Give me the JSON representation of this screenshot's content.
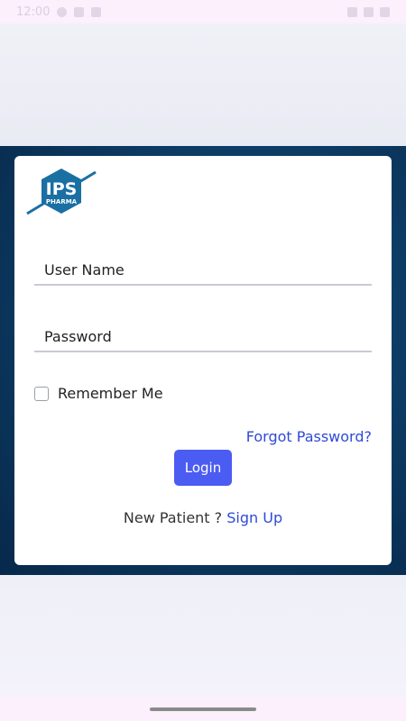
{
  "status_bar": {
    "time": "12:00"
  },
  "logo": {
    "title": "IPS",
    "subtitle": "PHARMA"
  },
  "form": {
    "username_placeholder": "User Name",
    "password_placeholder": "Password",
    "remember_label": "Remember Me",
    "forgot_label": "Forgot Password?",
    "login_label": "Login",
    "new_patient_text": "New Patient ?",
    "signup_label": "Sign Up"
  },
  "colors": {
    "accent": "#4b5cf2",
    "link": "#2f4ad6",
    "logo": "#1a6fa3"
  }
}
